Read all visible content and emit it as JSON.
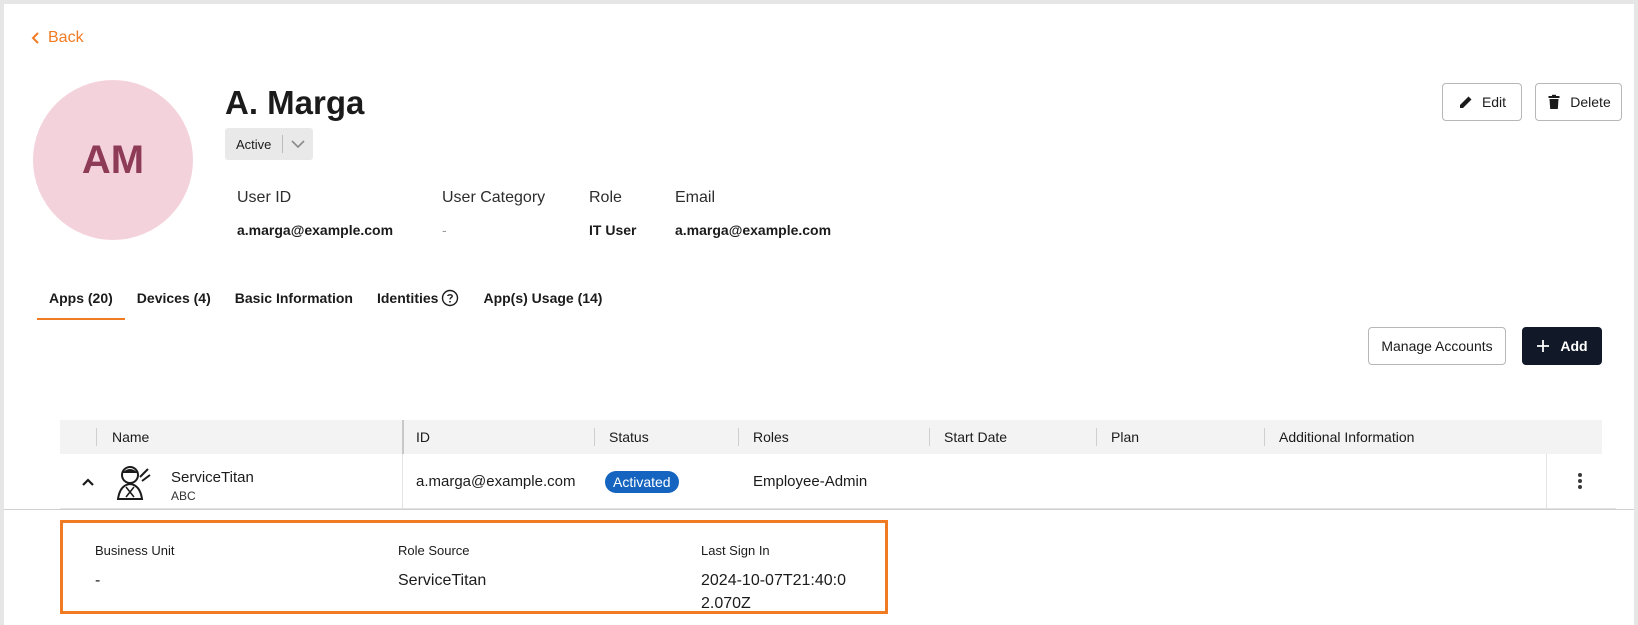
{
  "nav": {
    "back_label": "Back"
  },
  "user": {
    "initials": "AM",
    "name": "A. Marga",
    "status": "Active",
    "fields": [
      {
        "label": "User ID",
        "value": "a.marga@example.com"
      },
      {
        "label": "User Category",
        "value": "-"
      },
      {
        "label": "Role",
        "value": "IT User"
      },
      {
        "label": "Email",
        "value": "a.marga@example.com"
      }
    ]
  },
  "actions": {
    "edit_label": "Edit",
    "delete_label": "Delete"
  },
  "tabs": [
    {
      "label": "Apps (20)",
      "active": true
    },
    {
      "label": "Devices (4)",
      "active": false
    },
    {
      "label": "Basic Information",
      "active": false
    },
    {
      "label": "Identities",
      "active": false,
      "icon": "help-circle-icon"
    },
    {
      "label": "App(s) Usage (14)",
      "active": false
    }
  ],
  "toolbar": {
    "manage_label": "Manage Accounts",
    "add_label": "Add"
  },
  "table": {
    "columns": [
      "Name",
      "ID",
      "Status",
      "Roles",
      "Start Date",
      "Plan",
      "Additional Information"
    ],
    "rows": [
      {
        "name": "ServiceTitan",
        "subtitle": "ABC",
        "id": "a.marga@example.com",
        "status": "Activated",
        "roles": "Employee-Admin",
        "start_date": "",
        "plan": "",
        "additional": ""
      }
    ]
  },
  "detail": {
    "items": [
      {
        "label": "Business Unit",
        "value": "-"
      },
      {
        "label": "Role Source",
        "value": "ServiceTitan"
      },
      {
        "label": "Last Sign In",
        "value": "2024-10-07T21:40:02.070Z"
      }
    ]
  },
  "colors": {
    "accent": "#f07b22",
    "badge": "#1565c0",
    "dark_button": "#111827",
    "avatar_bg": "#f4d2dc",
    "avatar_text": "#8e3b58"
  }
}
